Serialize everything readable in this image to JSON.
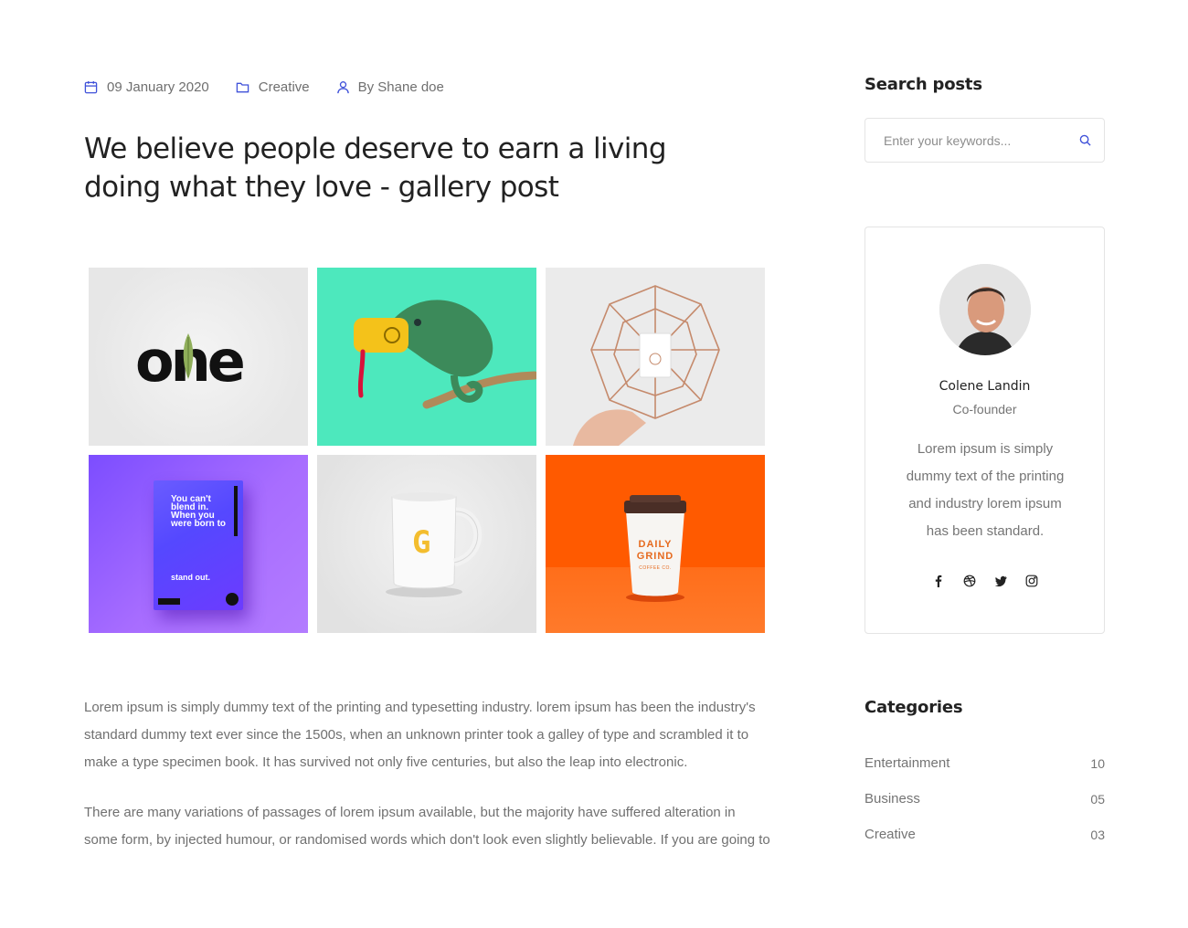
{
  "colors": {
    "accent": "#3f51d9",
    "heading": "#222222",
    "body_text": "#707070"
  },
  "post": {
    "meta": {
      "date": "09 January 2020",
      "category": "Creative",
      "author": "By Shane doe"
    },
    "title": "We believe people deserve to earn a living doing what they love - gallery post",
    "gallery": [
      {
        "icon": "one-logo-image",
        "text": "one"
      },
      {
        "icon": "chameleon-image"
      },
      {
        "icon": "wire-sphere-image"
      },
      {
        "icon": "poster-image",
        "text": "You can't blend in. When you were born to",
        "subtext": "stand out."
      },
      {
        "icon": "mug-image",
        "text": "G"
      },
      {
        "icon": "coffee-cup-image",
        "text": "DAILY GRIND",
        "subtext": "COFFEE CO."
      }
    ],
    "paragraphs": [
      "Lorem ipsum is simply dummy text of the printing and typesetting industry. lorem ipsum has been the industry's standard dummy text ever since the 1500s, when an unknown printer took a galley of type and scrambled it to make a type specimen book. It has survived not only five centuries, but also the leap into electronic.",
      "There are many variations of passages of lorem ipsum available, but the majority have suffered alteration in some form, by injected humour, or randomised words which don't look even slightly believable. If you are going to"
    ]
  },
  "sidebar": {
    "search": {
      "title": "Search posts",
      "placeholder": "Enter your keywords..."
    },
    "author": {
      "name": "Colene Landin",
      "role": "Co-founder",
      "bio": "Lorem ipsum is simply dummy text of the printing and industry lorem ipsum has been standard.",
      "socials": [
        "facebook-icon",
        "dribbble-icon",
        "twitter-icon",
        "instagram-icon"
      ]
    },
    "categories": {
      "title": "Categories",
      "items": [
        {
          "label": "Entertainment",
          "count": "10"
        },
        {
          "label": "Business",
          "count": "05"
        },
        {
          "label": "Creative",
          "count": "03"
        }
      ]
    }
  }
}
